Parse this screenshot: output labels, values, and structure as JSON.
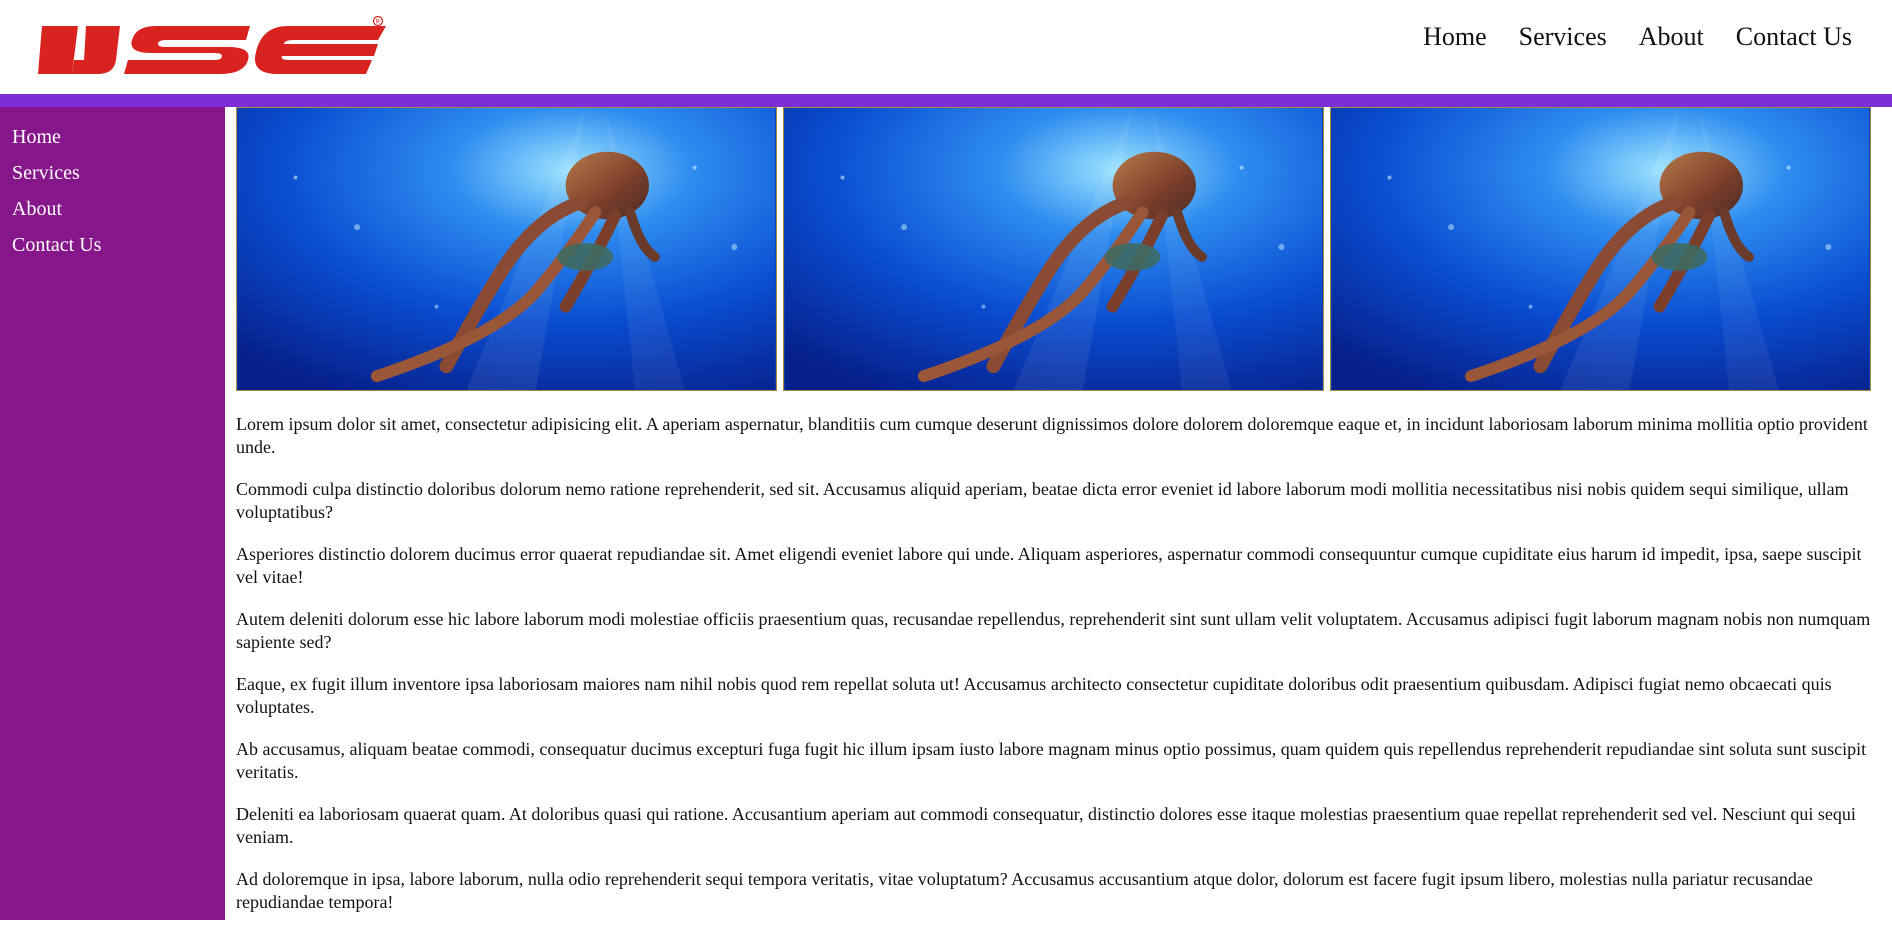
{
  "brand": {
    "logo_text": "IJSE",
    "registered_mark": "®",
    "logo_color": "#d8231f"
  },
  "top_nav": {
    "items": [
      {
        "label": "Home"
      },
      {
        "label": "Services"
      },
      {
        "label": "About"
      },
      {
        "label": "Contact Us"
      }
    ]
  },
  "side_nav": {
    "items": [
      {
        "label": "Home"
      },
      {
        "label": "Services"
      },
      {
        "label": "About"
      },
      {
        "label": "Contact Us"
      }
    ]
  },
  "colors": {
    "accent_bar": "#7c2fd6",
    "sidebar_bg": "#86178a",
    "image_border": "#a88a3c"
  },
  "gallery": {
    "images": [
      {
        "icon": "octopus-underwater-image"
      },
      {
        "icon": "octopus-underwater-image"
      },
      {
        "icon": "octopus-underwater-image"
      }
    ]
  },
  "content": {
    "paragraphs": [
      "Lorem ipsum dolor sit amet, consectetur adipisicing elit. A aperiam aspernatur, blanditiis cum cumque deserunt dignissimos dolore dolorem doloremque eaque et, in incidunt laboriosam laborum minima mollitia optio provident unde.",
      "Commodi culpa distinctio doloribus dolorum nemo ratione reprehenderit, sed sit. Accusamus aliquid aperiam, beatae dicta error eveniet id labore laborum modi mollitia necessitatibus nisi nobis quidem sequi similique, ullam voluptatibus?",
      "Asperiores distinctio dolorem ducimus error quaerat repudiandae sit. Amet eligendi eveniet labore qui unde. Aliquam asperiores, aspernatur commodi consequuntur cumque cupiditate eius harum id impedit, ipsa, saepe suscipit vel vitae!",
      "Autem deleniti dolorum esse hic labore laborum modi molestiae officiis praesentium quas, recusandae repellendus, reprehenderit sint sunt ullam velit voluptatem. Accusamus adipisci fugit laborum magnam nobis non numquam sapiente sed?",
      "Eaque, ex fugit illum inventore ipsa laboriosam maiores nam nihil nobis quod rem repellat soluta ut! Accusamus architecto consectetur cupiditate doloribus odit praesentium quibusdam. Adipisci fugiat nemo obcaecati quis voluptates.",
      "Ab accusamus, aliquam beatae commodi, consequatur ducimus excepturi fuga fugit hic illum ipsam iusto labore magnam minus optio possimus, quam quidem quis repellendus reprehenderit repudiandae sint soluta sunt suscipit veritatis.",
      "Deleniti ea laboriosam quaerat quam. At doloribus quasi qui ratione. Accusantium aperiam aut commodi consequatur, distinctio dolores esse itaque molestias praesentium quae repellat reprehenderit sed vel. Nesciunt qui sequi veniam.",
      "Ad doloremque in ipsa, labore laborum, nulla odio reprehenderit sequi tempora veritatis, vitae voluptatum? Accusamus accusantium atque dolor, dolorum est facere fugit ipsum libero, molestias nulla pariatur recusandae repudiandae tempora!"
    ]
  }
}
